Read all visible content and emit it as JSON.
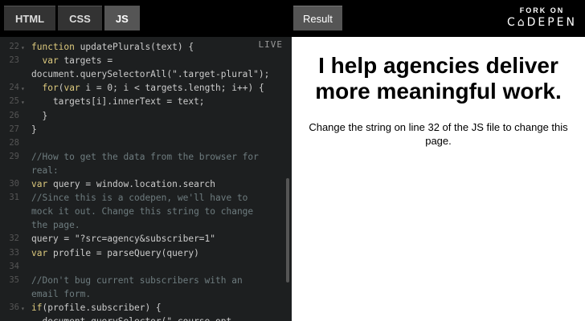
{
  "tabs": [
    {
      "label": "HTML",
      "active": false
    },
    {
      "label": "CSS",
      "active": false
    },
    {
      "label": "JS",
      "active": true
    }
  ],
  "result_tab": "Result",
  "fork": {
    "line1": "FORK ON",
    "line2": "C⌂DEPEN"
  },
  "editor": {
    "live_label": "LIVE",
    "lines": [
      {
        "n": "22",
        "fold": true,
        "parts": [
          [
            "kw",
            "function "
          ],
          [
            "",
            "updatePlurals(text) {"
          ]
        ]
      },
      {
        "n": "23",
        "fold": false,
        "parts": [
          [
            "",
            "  "
          ],
          [
            "kw",
            "var "
          ],
          [
            "",
            "targets ="
          ]
        ]
      },
      {
        "n": "",
        "fold": false,
        "parts": [
          [
            "",
            "document.querySelectorAll(\".target-plural\");"
          ]
        ]
      },
      {
        "n": "24",
        "fold": true,
        "parts": [
          [
            "",
            "  "
          ],
          [
            "kw",
            "for"
          ],
          [
            "",
            "("
          ],
          [
            "kw",
            "var "
          ],
          [
            "",
            "i = 0; i < targets.length; i++) {"
          ]
        ]
      },
      {
        "n": "25",
        "fold": true,
        "parts": [
          [
            "",
            "    targets[i].innerText = text;"
          ]
        ]
      },
      {
        "n": "26",
        "fold": false,
        "parts": [
          [
            "",
            "  }"
          ]
        ]
      },
      {
        "n": "27",
        "fold": false,
        "parts": [
          [
            "",
            "}"
          ]
        ]
      },
      {
        "n": "28",
        "fold": false,
        "parts": [
          [
            "",
            ""
          ]
        ]
      },
      {
        "n": "29",
        "fold": false,
        "parts": [
          [
            "com",
            "//How to get the data from the browser for"
          ]
        ]
      },
      {
        "n": "",
        "fold": false,
        "parts": [
          [
            "com",
            "real:"
          ]
        ]
      },
      {
        "n": "30",
        "fold": false,
        "parts": [
          [
            "kw",
            "var "
          ],
          [
            "",
            "query = window.location.search"
          ]
        ]
      },
      {
        "n": "31",
        "fold": false,
        "parts": [
          [
            "com",
            "//Since this is a codepen, we'll have to"
          ]
        ]
      },
      {
        "n": "",
        "fold": false,
        "parts": [
          [
            "com",
            "mock it out. Change this string to change"
          ]
        ]
      },
      {
        "n": "",
        "fold": false,
        "parts": [
          [
            "com",
            "the page."
          ]
        ]
      },
      {
        "n": "32",
        "fold": false,
        "parts": [
          [
            "",
            "query = \"?src=agency&subscriber=1\""
          ]
        ]
      },
      {
        "n": "33",
        "fold": false,
        "parts": [
          [
            "kw",
            "var "
          ],
          [
            "",
            "profile = parseQuery(query)"
          ]
        ]
      },
      {
        "n": "34",
        "fold": false,
        "parts": [
          [
            "",
            ""
          ]
        ]
      },
      {
        "n": "35",
        "fold": false,
        "parts": [
          [
            "com",
            "//Don't bug current subscribers with an"
          ]
        ]
      },
      {
        "n": "",
        "fold": false,
        "parts": [
          [
            "com",
            "email form."
          ]
        ]
      },
      {
        "n": "36",
        "fold": true,
        "parts": [
          [
            "kw",
            "if"
          ],
          [
            "",
            "(profile.subscriber) {"
          ]
        ]
      },
      {
        "n": "",
        "fold": false,
        "parts": [
          [
            "",
            "  document.querySelector(\".course-opt-"
          ]
        ]
      }
    ]
  },
  "result": {
    "heading": "I help agencies deliver more meaningful work.",
    "body": "Change the string on line 32 of the JS file to change this page."
  }
}
